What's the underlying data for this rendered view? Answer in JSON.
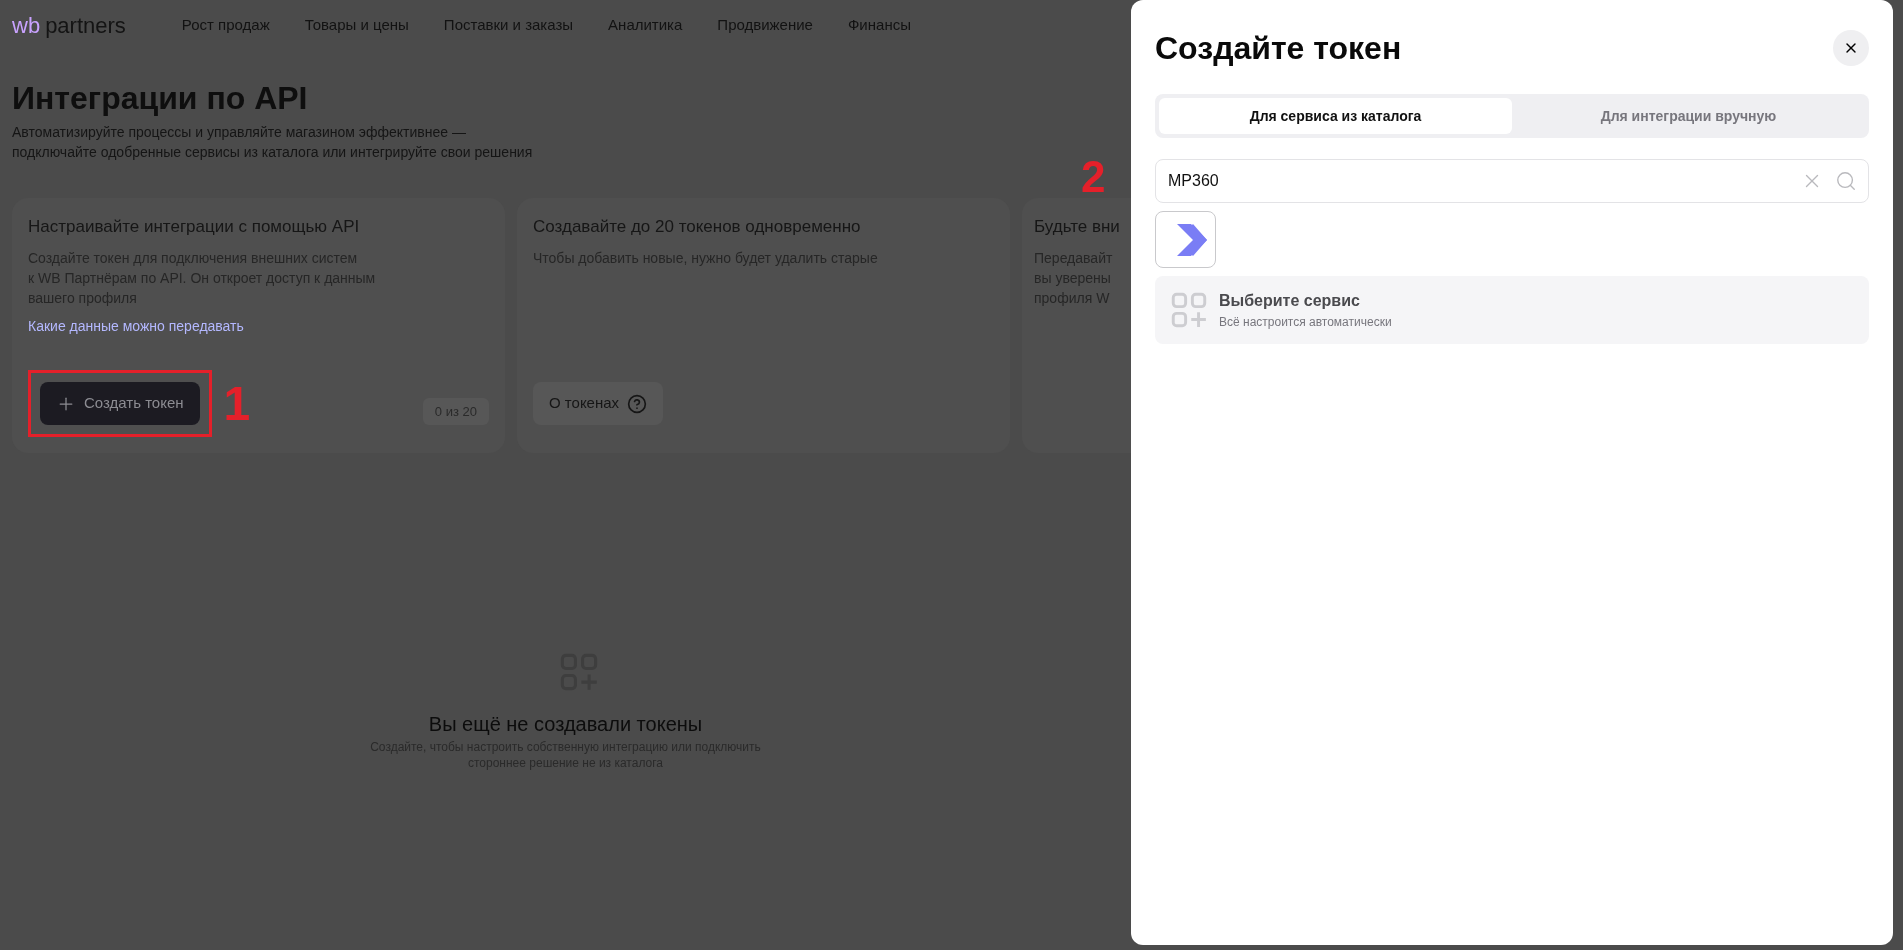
{
  "header": {
    "logo": {
      "brand": "wb",
      "name": "partners"
    },
    "nav": [
      {
        "label": "Рост продаж"
      },
      {
        "label": "Товары и цены"
      },
      {
        "label": "Поставки и заказы"
      },
      {
        "label": "Аналитика"
      },
      {
        "label": "Продвижение"
      },
      {
        "label": "Финансы"
      }
    ]
  },
  "page": {
    "title": "Интеграции по API",
    "subtitle_lines": [
      "Автоматизируйте процессы и управляйте магазином эффективнее —",
      "подключайте одобренные сервисы из каталога или интегрируйте свои решения"
    ]
  },
  "cards": [
    {
      "kind": "create",
      "title": "Настраивайте интеграции с помощью API",
      "description_lines": [
        "Создайте токен для подключения внешних систем",
        "к WB Партнёрам по API. Он откроет доступ к данным",
        "вашего профиля"
      ],
      "link": "Какие данные можно передавать",
      "button": "Создать токен",
      "counter": "0 из 20",
      "annotation": "1"
    },
    {
      "kind": "info",
      "title": "Создавайте до 20 токенов одновременно",
      "description_lines": [
        "Чтобы добавить новые, нужно будет удалить старые"
      ],
      "button": "О токенах"
    },
    {
      "kind": "cut",
      "title": "Будьте вни",
      "description_lines": [
        "Передавайт",
        "вы уверены",
        "профиля W"
      ]
    }
  ],
  "empty_state": {
    "title": "Вы ещё не создавали токены",
    "description_lines": [
      "Создайте, чтобы настроить собственную интеграцию или подключить",
      "стороннее решение не из каталога"
    ]
  },
  "modal": {
    "title": "Создайте токен",
    "tabs": [
      {
        "label": "Для сервиса из каталога",
        "selected": true
      },
      {
        "label": "Для интеграции вручную",
        "selected": false
      }
    ],
    "search": {
      "value": "MP360"
    },
    "annotation": "2",
    "service_row": {
      "title": "Выберите сервис",
      "subtitle": "Всё настроится автоматически"
    }
  }
}
